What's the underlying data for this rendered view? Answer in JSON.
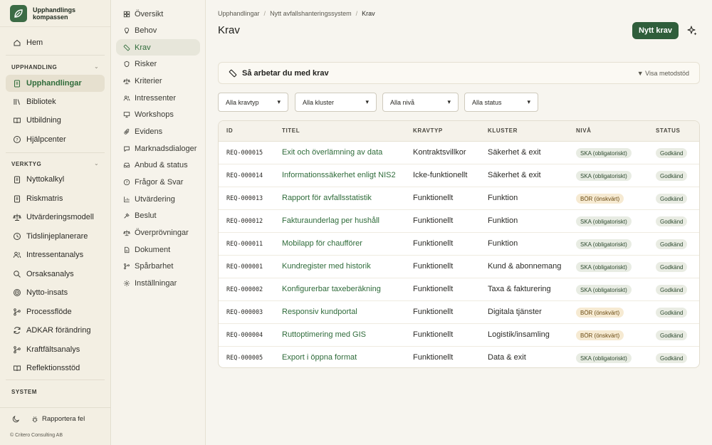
{
  "brand": {
    "name": "Upphandlings kompassen",
    "logo_icon": "leaf-logo-icon"
  },
  "sidebar": {
    "home": {
      "label": "Hem",
      "icon": "home-icon"
    },
    "sections": {
      "upphandling": "UPPHANDLING",
      "verktyg": "VERKTYG",
      "system": "SYSTEM"
    },
    "upphandling_items": [
      {
        "label": "Upphandlingar",
        "icon": "clipboard-icon",
        "active": true
      },
      {
        "label": "Bibliotek",
        "icon": "library-icon"
      },
      {
        "label": "Utbildning",
        "icon": "book-open-icon"
      },
      {
        "label": "Hjälpcenter",
        "icon": "help-circle-icon"
      }
    ],
    "verktyg_items": [
      {
        "label": "Nyttokalkyl",
        "icon": "clipboard-icon"
      },
      {
        "label": "Riskmatris",
        "icon": "clipboard-icon"
      },
      {
        "label": "Utvärderingsmodell",
        "icon": "scale-icon"
      },
      {
        "label": "Tidslinjeplanerare",
        "icon": "clock-icon"
      },
      {
        "label": "Intressentanalys",
        "icon": "users-icon"
      },
      {
        "label": "Orsaksanalys",
        "icon": "search-icon"
      },
      {
        "label": "Nytto-insats",
        "icon": "target-icon"
      },
      {
        "label": "Processflöde",
        "icon": "flow-icon"
      },
      {
        "label": "ADKAR förändring",
        "icon": "refresh-icon"
      },
      {
        "label": "Kraftfältsanalys",
        "icon": "flow-icon"
      },
      {
        "label": "Reflektionsstöd",
        "icon": "book-icon"
      }
    ],
    "footer": {
      "theme_icon": "moon-icon",
      "report_label": "Rapportera fel",
      "report_icon": "bug-icon",
      "copyright": "© Critero Consulting AB"
    }
  },
  "subnav": [
    {
      "label": "Översikt",
      "icon": "grid-icon"
    },
    {
      "label": "Behov",
      "icon": "lightbulb-icon"
    },
    {
      "label": "Krav",
      "icon": "ruler-icon",
      "active": true
    },
    {
      "label": "Risker",
      "icon": "shield-icon"
    },
    {
      "label": "Kriterier",
      "icon": "scale-icon"
    },
    {
      "label": "Intressenter",
      "icon": "users-icon"
    },
    {
      "label": "Workshops",
      "icon": "presentation-icon"
    },
    {
      "label": "Evidens",
      "icon": "paperclip-icon"
    },
    {
      "label": "Marknadsdialoger",
      "icon": "chat-icon"
    },
    {
      "label": "Anbud & status",
      "icon": "inbox-icon"
    },
    {
      "label": "Frågor & Svar",
      "icon": "help-circle-icon"
    },
    {
      "label": "Utvärdering",
      "icon": "bar-chart-icon"
    },
    {
      "label": "Beslut",
      "icon": "gavel-icon"
    },
    {
      "label": "Överprövningar",
      "icon": "scale-icon"
    },
    {
      "label": "Dokument",
      "icon": "document-icon"
    },
    {
      "label": "Spårbarhet",
      "icon": "branch-icon"
    },
    {
      "label": "Inställningar",
      "icon": "gear-icon"
    }
  ],
  "header": {
    "breadcrumb": [
      "Upphandlingar",
      "Nytt avfallshanteringssystem",
      "Krav"
    ],
    "title": "Krav",
    "new_button": "Nytt krav",
    "ai_icon": "sparkle-icon"
  },
  "guide": {
    "title": "Så arbetar du med krav",
    "toggle": "▼ Visa metodstöd",
    "icon": "ruler-icon"
  },
  "filters": [
    {
      "selected": "Alla kravtyp"
    },
    {
      "selected": "Alla kluster"
    },
    {
      "selected": "Alla nivå"
    },
    {
      "selected": "Alla status"
    }
  ],
  "table": {
    "columns": [
      "ID",
      "TITEL",
      "KRAVTYP",
      "KLUSTER",
      "NIVÅ",
      "STATUS"
    ],
    "rows": [
      {
        "id": "REQ-000015",
        "title": "Exit och överlämning av data",
        "type": "Kontraktsvillkor",
        "cluster": "Säkerhet & exit",
        "level": "SKA (obligatoriskt)",
        "level_kind": "ska",
        "status": "Godkänd"
      },
      {
        "id": "REQ-000014",
        "title": "Informationssäkerhet enligt NIS2",
        "type": "Icke-funktionellt",
        "cluster": "Säkerhet & exit",
        "level": "SKA (obligatoriskt)",
        "level_kind": "ska",
        "status": "Godkänd"
      },
      {
        "id": "REQ-000013",
        "title": "Rapport för avfallsstatistik",
        "type": "Funktionellt",
        "cluster": "Funktion",
        "level": "BÖR (önskvärt)",
        "level_kind": "bor",
        "status": "Godkänd"
      },
      {
        "id": "REQ-000012",
        "title": "Fakturaunderlag per hushåll",
        "type": "Funktionellt",
        "cluster": "Funktion",
        "level": "SKA (obligatoriskt)",
        "level_kind": "ska",
        "status": "Godkänd"
      },
      {
        "id": "REQ-000011",
        "title": "Mobilapp för chaufförer",
        "type": "Funktionellt",
        "cluster": "Funktion",
        "level": "SKA (obligatoriskt)",
        "level_kind": "ska",
        "status": "Godkänd"
      },
      {
        "id": "REQ-000001",
        "title": "Kundregister med historik",
        "type": "Funktionellt",
        "cluster": "Kund & abonnemang",
        "level": "SKA (obligatoriskt)",
        "level_kind": "ska",
        "status": "Godkänd"
      },
      {
        "id": "REQ-000002",
        "title": "Konfigurerbar taxeberäkning",
        "type": "Funktionellt",
        "cluster": "Taxa & fakturering",
        "level": "SKA (obligatoriskt)",
        "level_kind": "ska",
        "status": "Godkänd"
      },
      {
        "id": "REQ-000003",
        "title": "Responsiv kundportal",
        "type": "Funktionellt",
        "cluster": "Digitala tjänster",
        "level": "BÖR (önskvärt)",
        "level_kind": "bor",
        "status": "Godkänd"
      },
      {
        "id": "REQ-000004",
        "title": "Ruttoptimering med GIS",
        "type": "Funktionellt",
        "cluster": "Logistik/insamling",
        "level": "BÖR (önskvärt)",
        "level_kind": "bor",
        "status": "Godkänd"
      },
      {
        "id": "REQ-000005",
        "title": "Export i öppna format",
        "type": "Funktionellt",
        "cluster": "Data & exit",
        "level": "SKA (obligatoriskt)",
        "level_kind": "ska",
        "status": "Godkänd"
      }
    ]
  },
  "colors": {
    "accent": "#2f5e3b",
    "link": "#2f6b3a",
    "ska_bg": "#e8ece3",
    "bor_bg": "#f6ead2"
  }
}
